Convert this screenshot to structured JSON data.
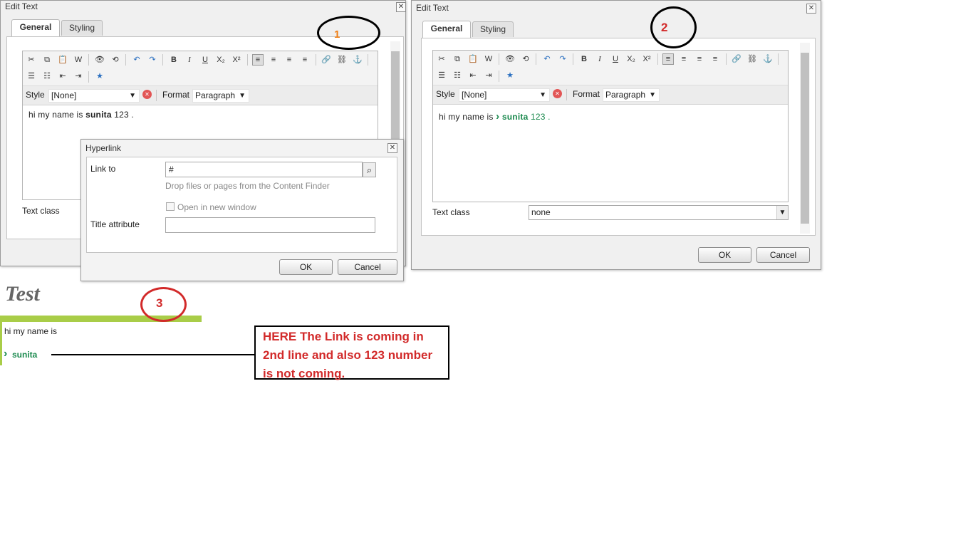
{
  "dialog1": {
    "title": "Edit Text",
    "close": "✕",
    "tabs": [
      "General",
      "Styling"
    ],
    "style_label": "Style",
    "style_value": "[None]",
    "format_label": "Format",
    "format_value": "Paragraph",
    "content_prefix": "hi my name is ",
    "content_bold": "sunita",
    "content_suffix": " 123 .",
    "text_class_label": "Text class"
  },
  "hyperlink": {
    "title": "Hyperlink",
    "close": "✕",
    "link_to_label": "Link to",
    "link_to_value": "#",
    "hint": "Drop files or pages from the Content Finder",
    "open_new_window": "Open in new window",
    "title_attr_label": "Title attribute",
    "ok": "OK",
    "cancel": "Cancel"
  },
  "dialog2": {
    "title": "Edit Text",
    "close": "✕",
    "tabs": [
      "General",
      "Styling"
    ],
    "style_label": "Style",
    "style_value": "[None]",
    "format_label": "Format",
    "format_value": "Paragraph",
    "content_prefix": "hi my name is ",
    "content_link": "sunita",
    "content_suffix": " 123 .",
    "text_class_label": "Text class",
    "text_class_value": "none",
    "ok": "OK",
    "cancel": "Cancel"
  },
  "annotations": {
    "num1": "1",
    "num2": "2",
    "num3": "3",
    "callout": "HERE The Link is coming in 2nd line and also 123 number is not coming."
  },
  "preview": {
    "title": "Test",
    "line1": "hi my name is",
    "link": "sunita"
  },
  "icons": {
    "cut": "✂",
    "copy": "⧉",
    "paste": "📋",
    "paste_word": "W",
    "find": "👁",
    "replace": "⟲",
    "undo": "↶",
    "redo": "↷",
    "bold": "B",
    "italic": "I",
    "underline": "U",
    "sub": "X₂",
    "sup": "X²",
    "align_left": "≡",
    "align_center": "≡",
    "align_right": "≡",
    "justify": "≡",
    "link": "🔗",
    "unlink": "⛓",
    "anchor": "⚓",
    "bullets": "☰",
    "numbers": "☷",
    "outdent": "⇤",
    "indent": "⇥",
    "special": "★",
    "clear": "✕",
    "chevron": "▼",
    "search": "⌕",
    "link_arrow": "›"
  },
  "colors": {
    "accent_green": "#a9cd48",
    "link_green": "#1b8a4e",
    "annotation_red": "#d22a2a",
    "annotation_orange": "#f07f16"
  }
}
